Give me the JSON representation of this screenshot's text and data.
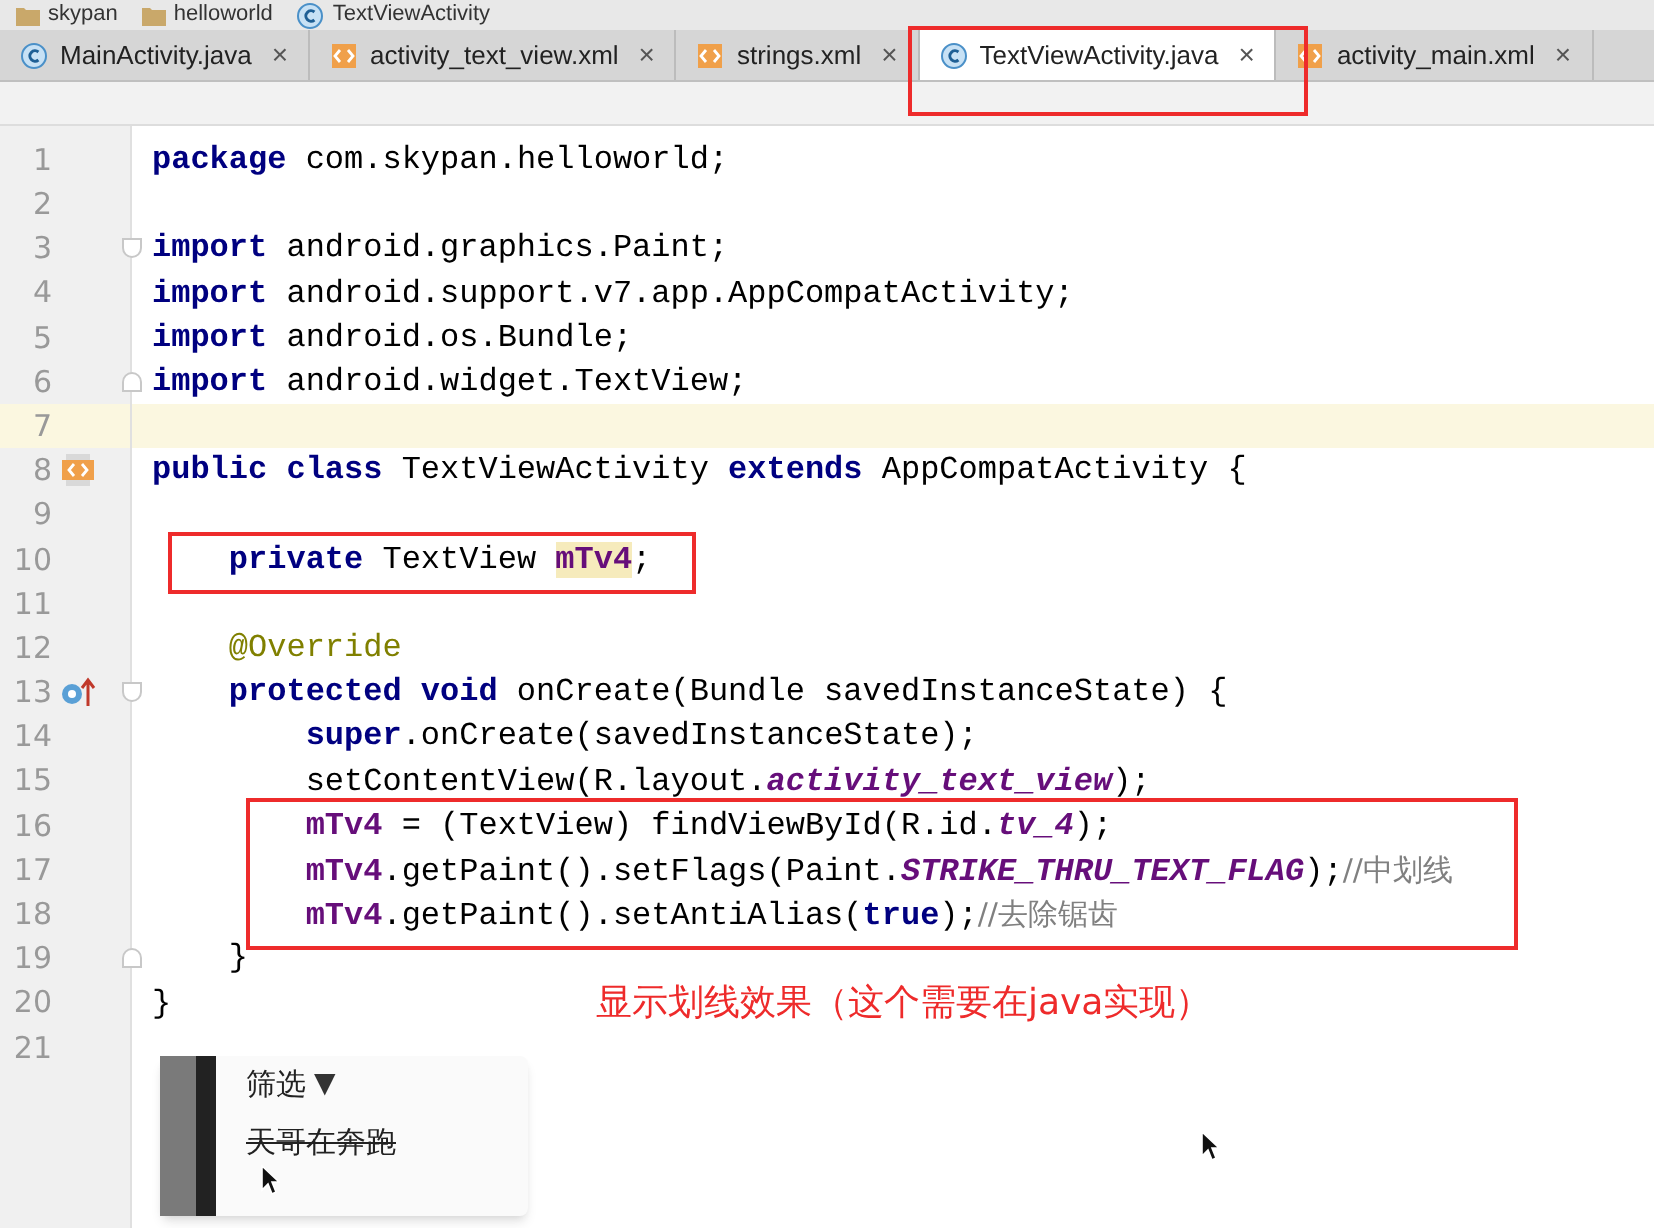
{
  "breadcrumb": [
    {
      "label": "skypan",
      "kind": "folder"
    },
    {
      "label": "helloworld",
      "kind": "folder"
    },
    {
      "label": "TextViewActivity",
      "kind": "class"
    }
  ],
  "tabs": [
    {
      "label": "MainActivity.java",
      "kind": "class",
      "selected": false,
      "boxed": false
    },
    {
      "label": "activity_text_view.xml",
      "kind": "xml",
      "selected": false,
      "boxed": false
    },
    {
      "label": "strings.xml",
      "kind": "xml",
      "selected": false,
      "boxed": false
    },
    {
      "label": "TextViewActivity.java",
      "kind": "class",
      "selected": true,
      "boxed": true
    },
    {
      "label": "activity_main.xml",
      "kind": "xml",
      "selected": false,
      "boxed": false
    }
  ],
  "tab_close": "×",
  "editor": {
    "lines": [
      {
        "number": "1",
        "current": false,
        "boxed": false,
        "tokens": [
          {
            "text": "package",
            "kind": "keyword"
          },
          {
            "text": " com.skypan.helloworld;",
            "kind": "plain"
          }
        ]
      },
      {
        "number": "2",
        "current": false,
        "boxed": false
      },
      {
        "number": "3",
        "current": false,
        "boxed": false,
        "gutter_icons": [
          {
            "kind": "fold-start"
          }
        ],
        "tokens": [
          {
            "text": "import",
            "kind": "keyword"
          },
          {
            "text": " android.graphics.Paint;",
            "kind": "plain"
          }
        ]
      },
      {
        "number": "4",
        "current": false,
        "boxed": false,
        "tokens": [
          {
            "text": "import",
            "kind": "keyword"
          },
          {
            "text": " android.support.v7.app.AppCompatActivity;",
            "kind": "plain"
          }
        ]
      },
      {
        "number": "5",
        "current": false,
        "boxed": false,
        "tokens": [
          {
            "text": "import",
            "kind": "keyword"
          },
          {
            "text": " android.os.Bundle;",
            "kind": "plain"
          }
        ]
      },
      {
        "number": "6",
        "current": false,
        "boxed": false,
        "gutter_icons": [
          {
            "kind": "fold-end"
          }
        ],
        "tokens": [
          {
            "text": "import",
            "kind": "keyword"
          },
          {
            "text": " android.widget.TextView;",
            "kind": "plain"
          }
        ]
      },
      {
        "number": "7",
        "current": true,
        "boxed": false
      },
      {
        "number": "8",
        "current": false,
        "boxed": false,
        "gutter_icons": [
          {
            "kind": "class"
          }
        ],
        "tokens": [
          {
            "text": "public class",
            "kind": "keyword"
          },
          {
            "text": " TextViewActivity ",
            "kind": "plain"
          },
          {
            "text": "extends",
            "kind": "keyword"
          },
          {
            "text": " AppCompatActivity {",
            "kind": "plain"
          }
        ]
      },
      {
        "number": "9",
        "current": false,
        "boxed": false
      },
      {
        "number": "10",
        "current": false,
        "boxed": true,
        "tokens": [
          {
            "text": "    private",
            "kind": "keyword"
          },
          {
            "text": " TextView ",
            "kind": "plain"
          },
          {
            "text": "mTv4",
            "kind": "field-usage"
          },
          {
            "text": ";",
            "kind": "plain"
          }
        ]
      },
      {
        "number": "11",
        "current": false,
        "boxed": false
      },
      {
        "number": "12",
        "current": false,
        "boxed": false,
        "tokens": [
          {
            "text": "    @Override",
            "kind": "annotation"
          }
        ]
      },
      {
        "number": "13",
        "current": false,
        "boxed": false,
        "gutter_icons": [
          {
            "kind": "override"
          },
          {
            "kind": "fold-start"
          }
        ],
        "tokens": [
          {
            "text": "    protected void",
            "kind": "keyword"
          },
          {
            "text": " onCreate(Bundle savedInstanceState) {",
            "kind": "plain"
          }
        ]
      },
      {
        "number": "14",
        "current": false,
        "boxed": false,
        "tokens": [
          {
            "text": "        super",
            "kind": "keyword"
          },
          {
            "text": ".onCreate(savedInstanceState);",
            "kind": "plain"
          }
        ]
      },
      {
        "number": "15",
        "current": false,
        "boxed": false,
        "tokens": [
          {
            "text": "        setContentView(R.layout.",
            "kind": "plain"
          },
          {
            "text": "activity_text_view",
            "kind": "constant"
          },
          {
            "text": ");",
            "kind": "plain"
          }
        ]
      },
      {
        "number": "16",
        "current": false,
        "boxed": true,
        "tokens": [
          {
            "text": "        mTv4",
            "kind": "field"
          },
          {
            "text": " = (TextView) findViewById(R.id.",
            "kind": "plain"
          },
          {
            "text": "tv_4",
            "kind": "constant"
          },
          {
            "text": ");",
            "kind": "plain"
          }
        ]
      },
      {
        "number": "17",
        "current": false,
        "boxed": true,
        "tokens": [
          {
            "text": "        mTv4",
            "kind": "field"
          },
          {
            "text": ".getPaint().setFlags(Paint.",
            "kind": "plain"
          },
          {
            "text": "STRIKE_THRU_TEXT_FLAG",
            "kind": "constant"
          },
          {
            "text": ");",
            "kind": "plain"
          },
          {
            "text": "//中划线",
            "kind": "comment"
          }
        ]
      },
      {
        "number": "18",
        "current": false,
        "boxed": true,
        "tokens": [
          {
            "text": "        mTv4",
            "kind": "field"
          },
          {
            "text": ".getPaint().setAntiAlias(",
            "kind": "plain"
          },
          {
            "text": "true",
            "kind": "keyword"
          },
          {
            "text": ");",
            "kind": "plain"
          },
          {
            "text": "//去除锯齿",
            "kind": "comment"
          }
        ]
      },
      {
        "number": "19",
        "current": false,
        "boxed": false,
        "gutter_icons": [
          {
            "kind": "fold-end"
          }
        ],
        "tokens": [
          {
            "text": "    }",
            "kind": "plain"
          }
        ]
      },
      {
        "number": "20",
        "current": false,
        "boxed": false,
        "tokens": [
          {
            "text": "}",
            "kind": "plain"
          }
        ]
      },
      {
        "number": "21",
        "current": false,
        "boxed": false
      }
    ]
  },
  "note": "显示划线效果（这个需要在java实现）",
  "preview": {
    "title": "筛选",
    "caret": "▼",
    "items": [
      {
        "text": "天哥在奔跑",
        "strikethrough": true
      }
    ]
  }
}
